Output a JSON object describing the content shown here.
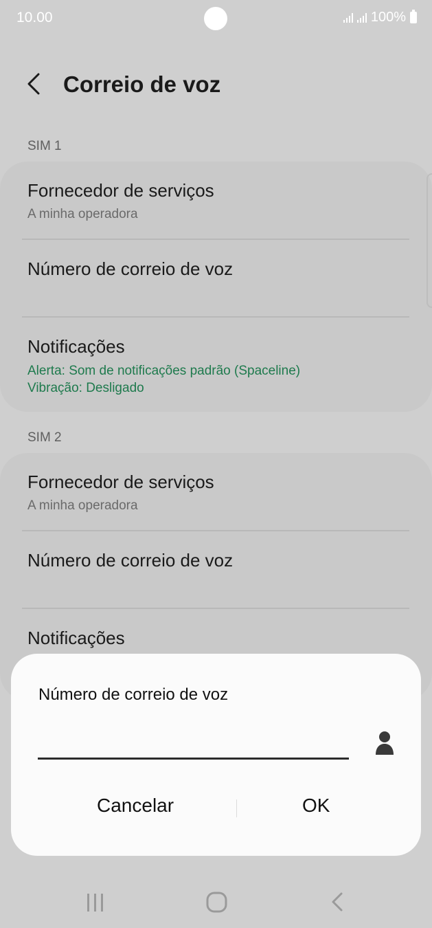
{
  "status": {
    "time": "10.00",
    "battery": "100%"
  },
  "header": {
    "title": "Correio de voz"
  },
  "sim1": {
    "label": "SIM 1",
    "provider": {
      "title": "Fornecedor de serviços",
      "subtitle": "A minha operadora"
    },
    "voicemail": {
      "title": "Número de correio de voz"
    },
    "notifications": {
      "title": "Notificações",
      "alert": "Alerta: Som de notificações padrão (Spaceline)",
      "vibration": "Vibração: Desligado"
    }
  },
  "sim2": {
    "label": "SIM 2",
    "provider": {
      "title": "Fornecedor de serviços",
      "subtitle": "A minha operadora"
    },
    "voicemail": {
      "title": "Número de correio de voz"
    },
    "notifications": {
      "title": "Notificações"
    }
  },
  "dialog": {
    "title": "Número de correio de voz",
    "input_value": "",
    "cancel_label": "Cancelar",
    "ok_label": "OK"
  },
  "colors": {
    "accent_green": "#1e7a4d",
    "dim_background": "#cfcfcf",
    "dialog_background": "#fbfbfb"
  },
  "icons": [
    "back-icon",
    "contact-icon",
    "recents-icon",
    "home-icon",
    "nav-back-icon"
  ]
}
